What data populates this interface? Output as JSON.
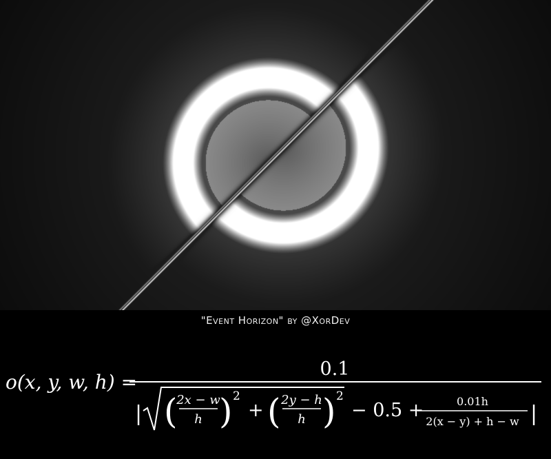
{
  "caption": "\"Event Horizon\" by @XorDev",
  "formula": {
    "lhs": "o(x, y, w, h) =",
    "numerator": "0.1",
    "abs_open": "|",
    "abs_close": "|",
    "term1_num": "2x − w",
    "term1_den": "h",
    "term2_num": "2y − h",
    "term2_den": "h",
    "exponent": "2",
    "minus_const": "− 0.5 +",
    "plus": "+",
    "term3_num": "0.01h",
    "term3_den": "2(x − y) + h − w"
  },
  "colors": {
    "background": "#000000",
    "glow": "#ffffff",
    "text": "#ffffff"
  }
}
